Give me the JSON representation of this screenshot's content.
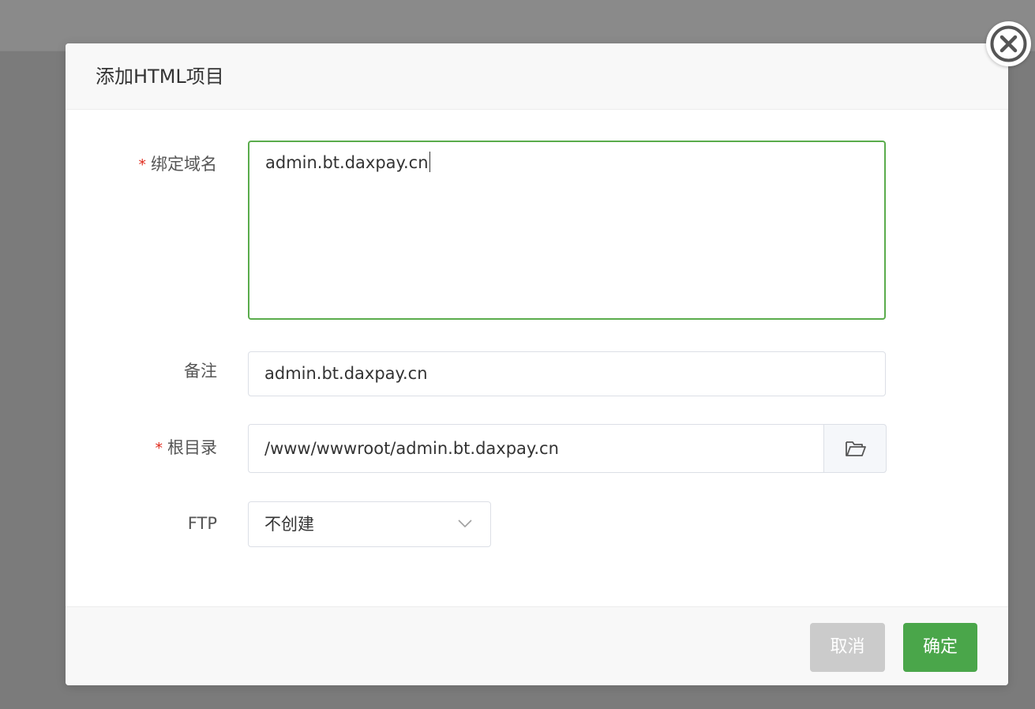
{
  "dialog": {
    "title": "添加HTML项目",
    "close_icon": "close-circle-icon"
  },
  "form": {
    "domain": {
      "required_mark": "*",
      "label": "绑定域名",
      "value": "admin.bt.daxpay.cn"
    },
    "note": {
      "label": "备注",
      "value": "admin.bt.daxpay.cn"
    },
    "root": {
      "required_mark": "*",
      "label": "根目录",
      "value": "/www/wwwroot/admin.bt.daxpay.cn",
      "browse_icon": "folder-open-icon"
    },
    "ftp": {
      "label": "FTP",
      "selected": "不创建",
      "dropdown_icon": "chevron-down-icon"
    }
  },
  "footer": {
    "cancel_label": "取消",
    "confirm_label": "确定"
  },
  "colors": {
    "overlay": "#7b7b7b",
    "focus_border": "#5aac4c",
    "confirm": "#4aa64a",
    "cancel": "#cbcbcb",
    "required": "#e0291b"
  }
}
